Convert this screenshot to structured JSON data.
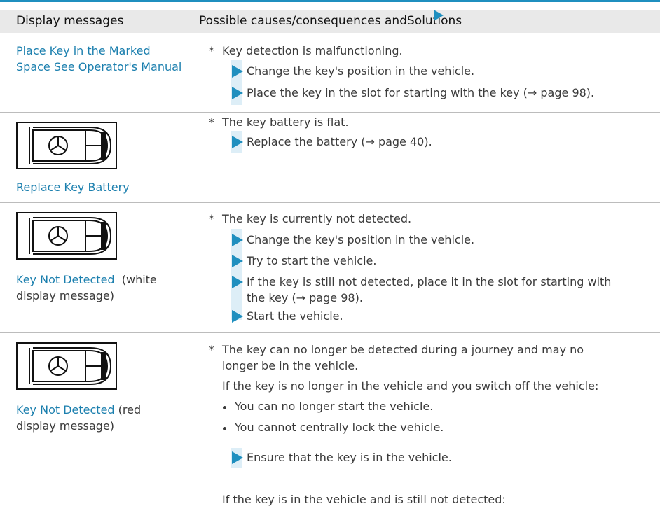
{
  "header": {
    "col1": "Display messages",
    "col2_before": "Possible causes/consequences and",
    "col2_after": "Solutions"
  },
  "rows": [
    {
      "message": "Place Key in the Marked Space See Operator's Manual",
      "cause": "Key detection is malfunctioning.",
      "solutions": [
        "Change the key's position in the vehicle.",
        "Place the key in the slot for starting with the key (→ page 98)."
      ]
    },
    {
      "icon": "key-fob-icon",
      "message": "Replace Key Battery",
      "cause": "The key battery is flat.",
      "solutions": [
        "Replace the battery (→ page 40)."
      ]
    },
    {
      "icon": "key-fob-icon",
      "message": "Key Not Detected",
      "message_suffix_line1": "(white",
      "message_line2": "display message)",
      "cause": "The key is currently not detected.",
      "solutions": [
        "Change the key's position in the vehicle.",
        "Try to start the vehicle.",
        "If the key is still not detected, place it in the slot for starting with",
        "the key (→ page 98).",
        "Start the vehicle."
      ]
    },
    {
      "icon": "key-fob-icon",
      "message": "Key Not Detected",
      "message_suffix_line1": "(red",
      "message_line2": "display message)",
      "cause_line1": "The key can no longer be detected during a journey and may no",
      "cause_line2": "longer be in the vehicle.",
      "condition": "If the key is no longer in the vehicle and you switch off the vehicle:",
      "bullets": [
        "You can no longer start the vehicle.",
        "You cannot centrally lock the vehicle."
      ],
      "solution": "Ensure that the key is in the vehicle.",
      "condition2": "If the key is in the vehicle and is still not detected:"
    }
  ],
  "colors": {
    "accent": "#1f8fbf",
    "link": "#1b7fae",
    "header_bg": "#e9e9e9"
  }
}
